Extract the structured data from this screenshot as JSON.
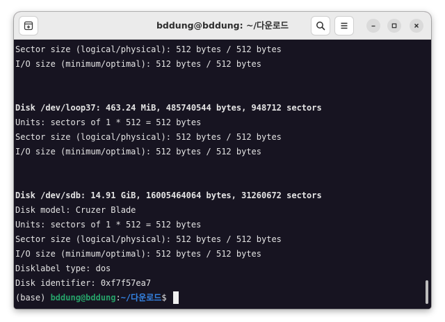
{
  "window": {
    "title": "bddung@bddung: ~/다운로드"
  },
  "titlebar": {
    "new_tab_icon": "new-tab-icon",
    "search_icon": "search-icon",
    "menu_icon": "hamburger-menu-icon",
    "minimize_icon": "minimize-icon",
    "maximize_icon": "maximize-icon",
    "close_icon": "close-icon"
  },
  "terminal": {
    "lines": [
      {
        "text": "Sector size (logical/physical): 512 bytes / 512 bytes",
        "bold": false
      },
      {
        "text": "I/O size (minimum/optimal): 512 bytes / 512 bytes",
        "bold": false
      },
      {
        "text": "",
        "bold": false
      },
      {
        "text": "",
        "bold": false
      },
      {
        "text": "Disk /dev/loop37: 463.24 MiB, 485740544 bytes, 948712 sectors",
        "bold": true
      },
      {
        "text": "Units: sectors of 1 * 512 = 512 bytes",
        "bold": false
      },
      {
        "text": "Sector size (logical/physical): 512 bytes / 512 bytes",
        "bold": false
      },
      {
        "text": "I/O size (minimum/optimal): 512 bytes / 512 bytes",
        "bold": false
      },
      {
        "text": "",
        "bold": false
      },
      {
        "text": "",
        "bold": false
      },
      {
        "text": "Disk /dev/sdb: 14.91 GiB, 16005464064 bytes, 31260672 sectors",
        "bold": true
      },
      {
        "text": "Disk model: Cruzer Blade",
        "bold": false
      },
      {
        "text": "Units: sectors of 1 * 512 = 512 bytes",
        "bold": false
      },
      {
        "text": "Sector size (logical/physical): 512 bytes / 512 bytes",
        "bold": false
      },
      {
        "text": "I/O size (minimum/optimal): 512 bytes / 512 bytes",
        "bold": false
      },
      {
        "text": "Disklabel type: dos",
        "bold": false
      },
      {
        "text": "Disk identifier: 0xf7f57ea7",
        "bold": false
      }
    ],
    "prompt": {
      "env": "(base) ",
      "user_host": "bddung@bddung",
      "sep": ":",
      "path": "~/다운로드",
      "symbol": "$ "
    }
  },
  "colors": {
    "terminal_bg": "#171421",
    "prompt_user": "#26a269",
    "prompt_path": "#3584e4",
    "titlebar_bg": "#ebebeb"
  }
}
